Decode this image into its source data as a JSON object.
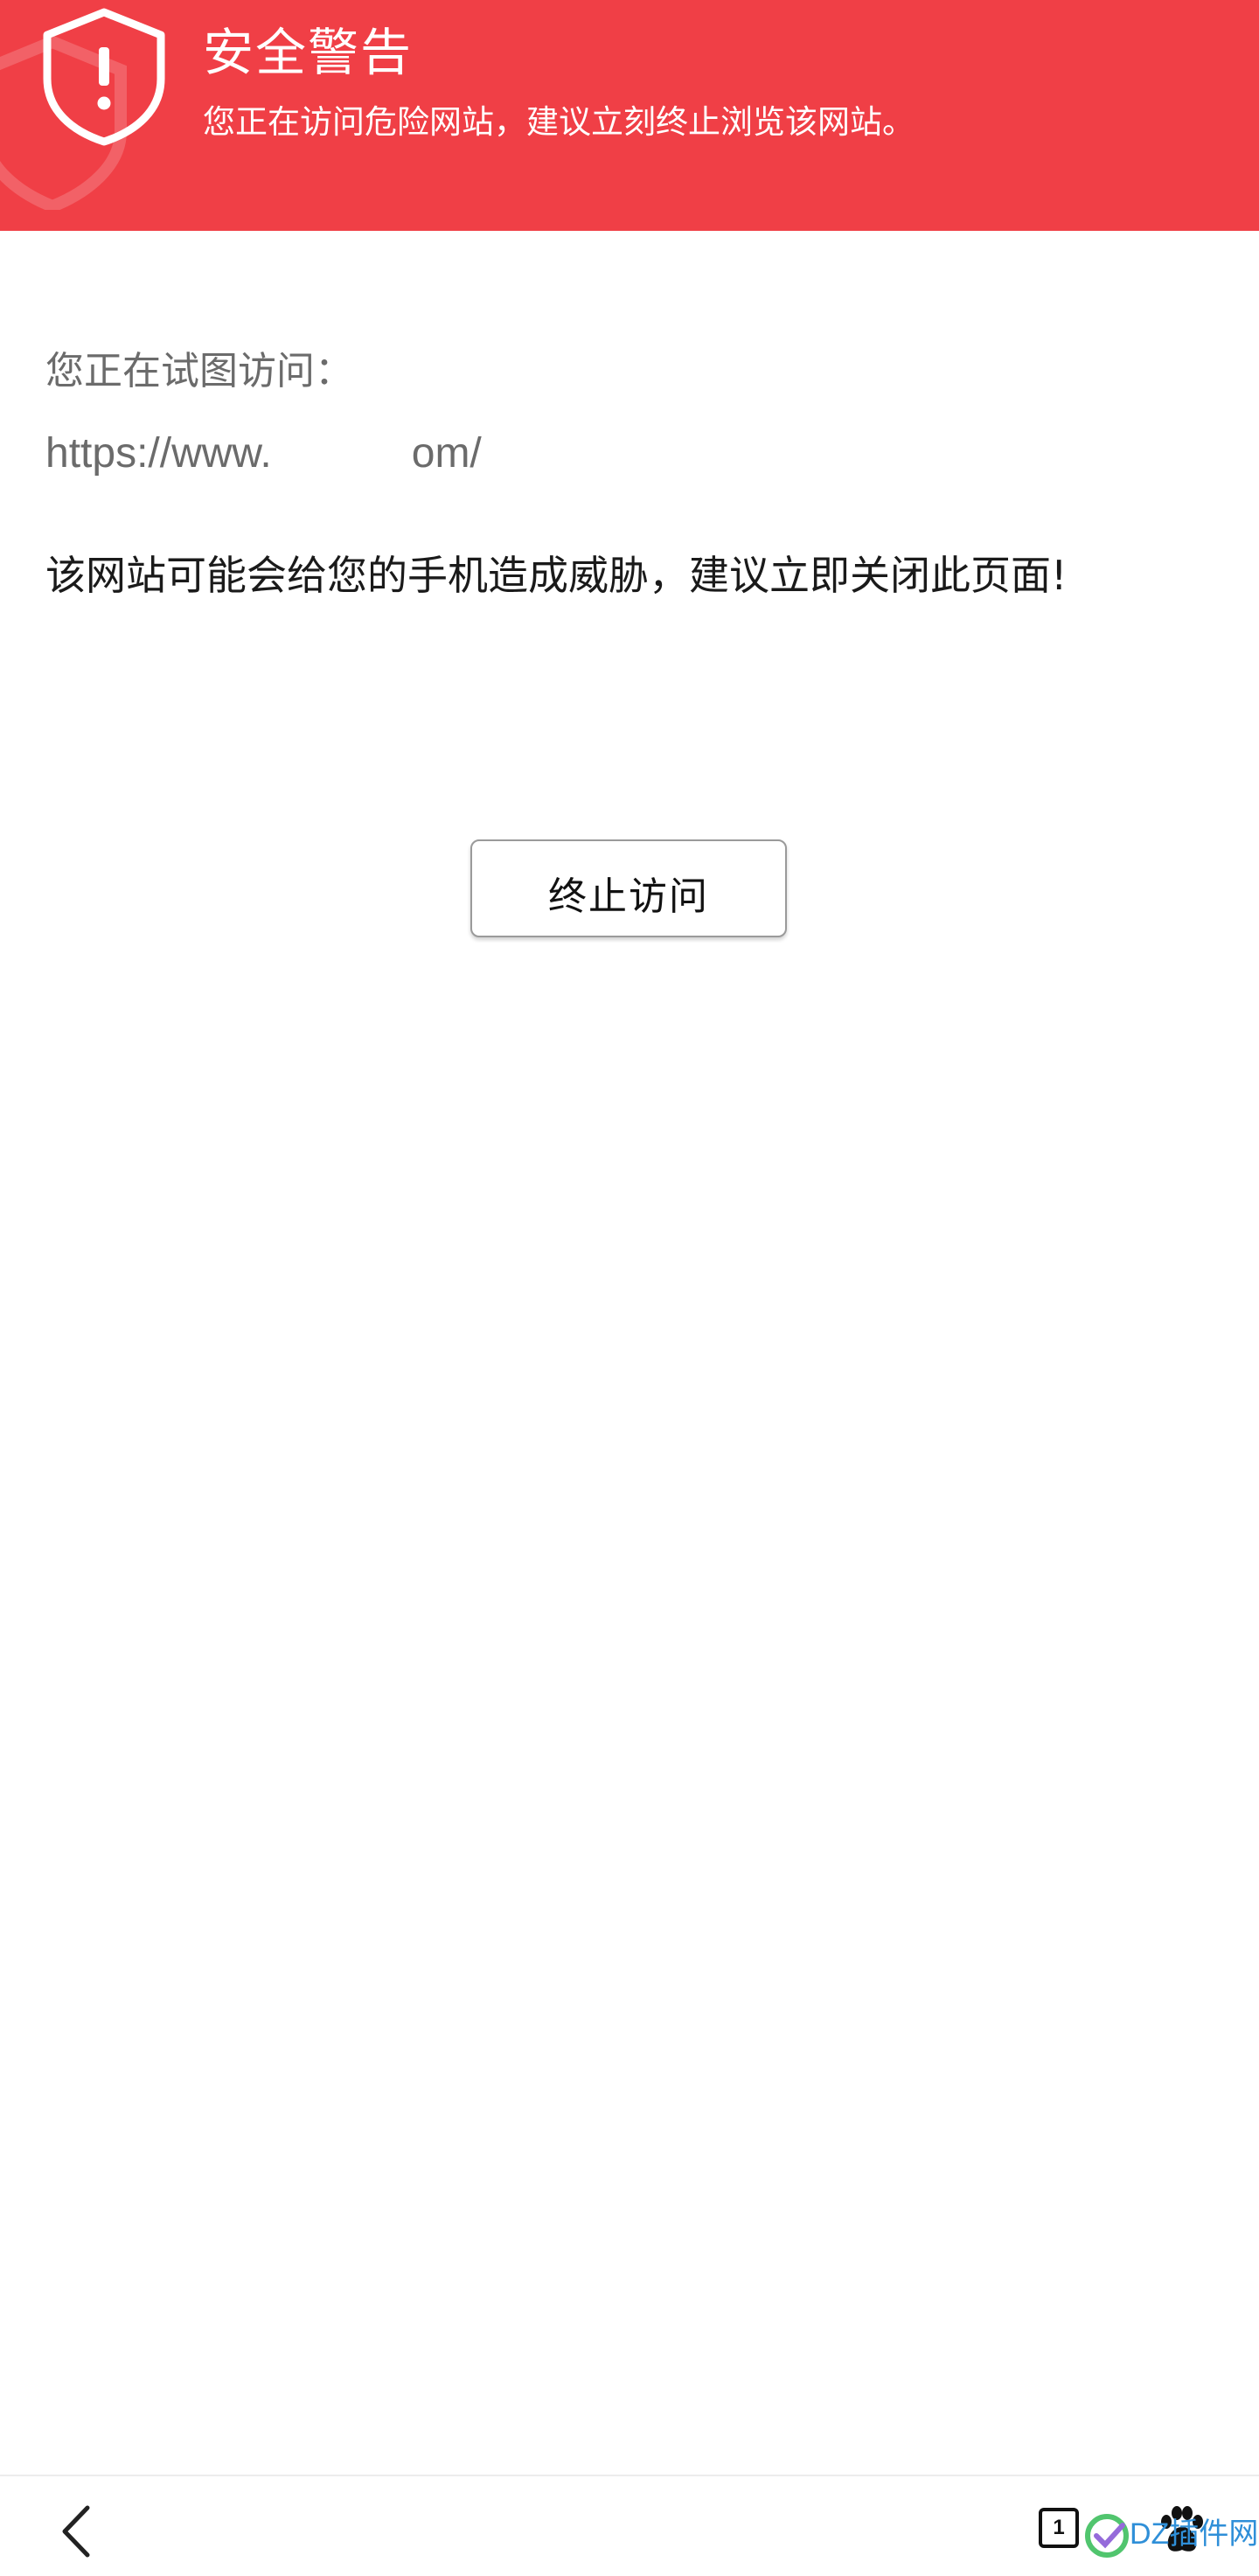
{
  "banner": {
    "title": "安全警告",
    "subtitle": "您正在访问危险网站，建议立刻终止浏览该网站。",
    "background_color": "#f03f46",
    "icon": "shield-exclamation-icon"
  },
  "main": {
    "visiting_label": "您正在试图访问：",
    "url_start": "https://www.",
    "url_end": "om/",
    "threat_message": "该网站可能会给您的手机造成威胁，建议立即关闭此页面!",
    "stop_button_label": "终止访问"
  },
  "bottom_bar": {
    "back_icon": "chevron-left-icon",
    "tab_count": "1",
    "paw_icon": "paw-icon"
  },
  "watermark": {
    "text": "DZ插件网"
  }
}
